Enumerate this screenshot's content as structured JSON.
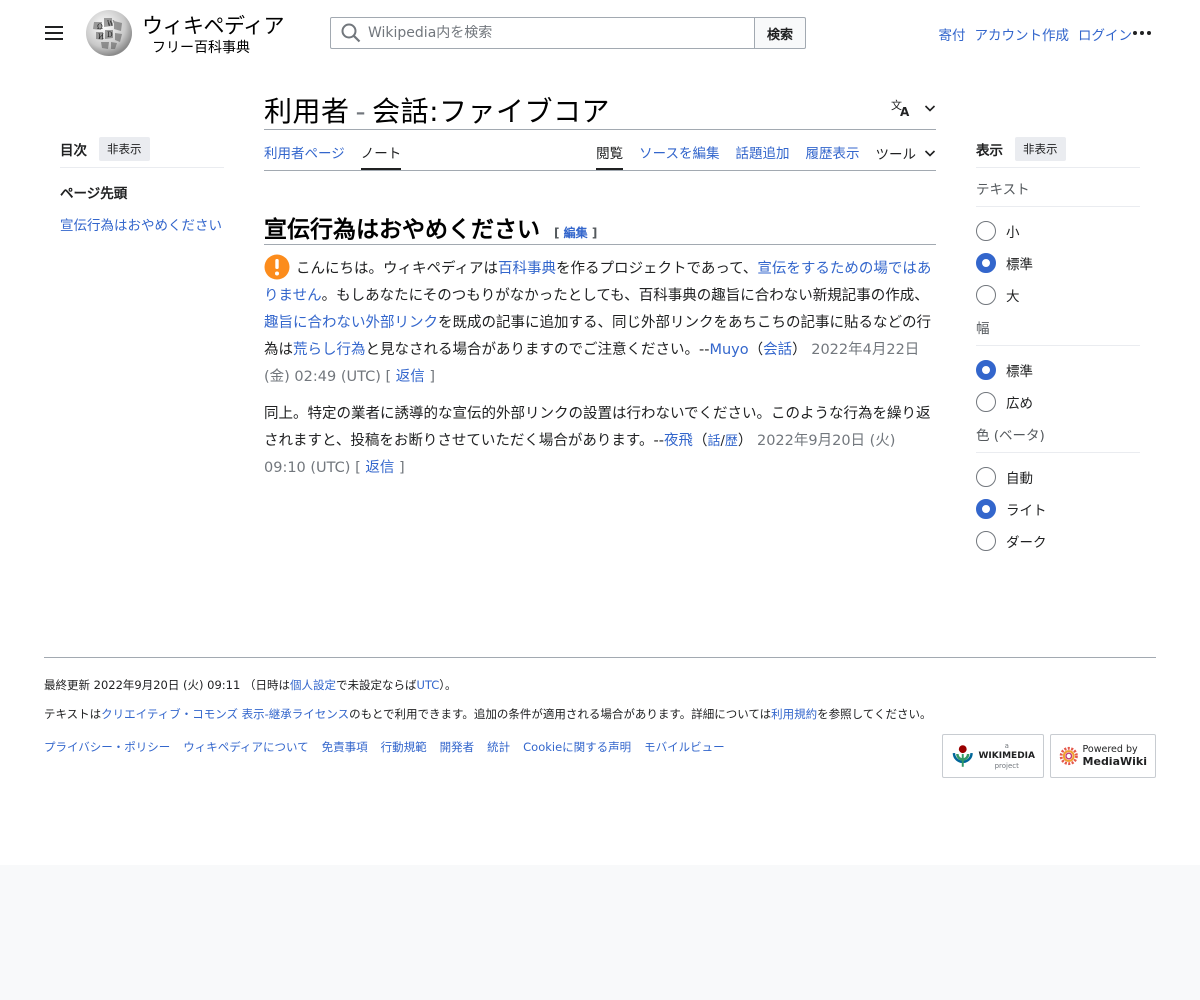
{
  "header": {
    "wordmark": "ウィキペディア",
    "tagline": "フリー百科事典",
    "search_placeholder": "Wikipedia内を検索",
    "search_button": "検索",
    "user_links": [
      "寄付",
      "アカウント作成",
      "ログイン"
    ]
  },
  "toc": {
    "title": "目次",
    "hide": "非表示",
    "top": "ページ先頭",
    "items": [
      "宣伝行為はおやめください"
    ]
  },
  "page": {
    "title_ns": "利用者",
    "title_sep": "-",
    "title_name": "会話:ファイブコア"
  },
  "tabs": {
    "left": [
      "利用者ページ",
      "ノート"
    ],
    "right": [
      "閲覧",
      "ソースを編集",
      "話題追加",
      "履歴表示"
    ],
    "tools": "ツール"
  },
  "section": {
    "heading": "宣伝行為はおやめください",
    "edit_open": "[",
    "edit": "編集",
    "edit_close": "]"
  },
  "comment1": {
    "t1": "こんにちは。ウィキペディアは",
    "l1": "百科事典",
    "t2": "を作るプロジェクトであって、",
    "l2": "宣伝をするための場ではありません",
    "t3": "。もしあなたにそのつもりがなかったとしても、百科事典の趣旨に合わない新規記事の作成、",
    "l3": "趣旨に合わない外部リンク",
    "t4": "を既成の記事に追加する、同じ外部リンクをあちこちの記事に貼るなどの行為は",
    "l4": "荒らし行為",
    "t5": "と見なされる場合がありますのでご注意ください。--",
    "user": "Muyo",
    "talk_open": "（",
    "talk": "会話",
    "talk_close": "）",
    "timestamp": "2022年4月22日 (金) 02:49 (UTC)",
    "reply_open": "[",
    "reply": "返信",
    "reply_close": "]"
  },
  "comment2": {
    "text": "同上。特定の業者に誘導的な宣伝的外部リンクの設置は行わないでください。このような行為を繰り返されますと、投稿をお断りさせていただく場合があります。--",
    "user": "夜飛",
    "open": "（",
    "talk": "話",
    "slash": "/",
    "hist": "歴",
    "close": "）",
    "timestamp": "2022年9月20日 (火) 09:10 (UTC)",
    "reply_open": "[",
    "reply": "返信",
    "reply_close": "]"
  },
  "appearance": {
    "title": "表示",
    "hide": "非表示",
    "text_label": "テキスト",
    "text_options": [
      "小",
      "標準",
      "大"
    ],
    "text_selected": "標準",
    "width_label": "幅",
    "width_options": [
      "標準",
      "広め"
    ],
    "width_selected": "標準",
    "color_label": "色 (ベータ)",
    "color_options": [
      "自動",
      "ライト",
      "ダーク"
    ],
    "color_selected": "ライト"
  },
  "footer": {
    "lastmod_pre": "最終更新 2022年9月20日 (火) 09:11 （日時は",
    "lastmod_link1": "個人設定",
    "lastmod_mid": "で未設定ならば",
    "lastmod_link2": "UTC",
    "lastmod_post": "）。",
    "license_pre": "テキストは",
    "license_link1": "クリエイティブ・コモンズ 表示-継承ライセンス",
    "license_mid": "のもとで利用できます。追加の条件が適用される場合があります。詳細については",
    "license_link2": "利用規約",
    "license_post": "を参照してください。",
    "links": [
      "プライバシー・ポリシー",
      "ウィキペディアについて",
      "免責事項",
      "行動規範",
      "開発者",
      "統計",
      "Cookieに関する声明",
      "モバイルビュー"
    ],
    "wikimedia_small": "a",
    "wikimedia_big": "WIKIMEDIA",
    "wikimedia_sub": "project",
    "mediawiki_small": "Powered by",
    "mediawiki_big": "MediaWiki"
  },
  "colors": {
    "link": "#3366cc",
    "warning": "#fc8c1c",
    "radio_checked": "#3366cc"
  }
}
